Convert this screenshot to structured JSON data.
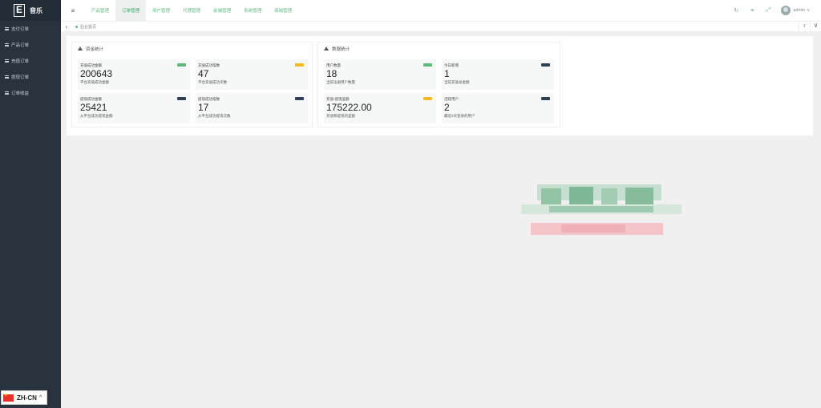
{
  "brand": {
    "logo_letter": "E",
    "name": "音乐"
  },
  "sidebar": {
    "items": [
      {
        "label": "支付订单"
      },
      {
        "label": "产品订单"
      },
      {
        "label": "充值订单"
      },
      {
        "label": "提现订单"
      },
      {
        "label": "订单收益"
      }
    ]
  },
  "language": {
    "label": "ZH-CN",
    "caret": "^"
  },
  "topnav": {
    "toggle_icon": "≡",
    "tabs": [
      {
        "label": "产品管理",
        "active": false
      },
      {
        "label": "订单管理",
        "active": true
      },
      {
        "label": "用户管理",
        "active": false
      },
      {
        "label": "代理管理",
        "active": false
      },
      {
        "label": "前端管理",
        "active": false
      },
      {
        "label": "系统管理",
        "active": false
      },
      {
        "label": "商城管理",
        "active": false
      }
    ],
    "refresh_icon": "↻",
    "clear_icon": "≡",
    "fullscreen_icon": "⤢",
    "username": "admin",
    "user_caret": "∨"
  },
  "pagebar": {
    "left_arrow": "‹",
    "tab_label": "后台首页",
    "right_arrow": "›",
    "down_arrow": "∨"
  },
  "panels": {
    "funds": {
      "title": "资金统计",
      "stats": [
        {
          "label": "充值成功金额",
          "value": "200643",
          "sub": "平台充值成功金额",
          "badge_color": "#5fb878"
        },
        {
          "label": "充值成功笔数",
          "value": "47",
          "sub": "平台充值成功次数",
          "badge_color": "#f7b824"
        },
        {
          "label": "提现成功金额",
          "value": "25421",
          "sub": "从平台成功提现金额",
          "badge_color": "#2f4056"
        },
        {
          "label": "提现成功笔数",
          "value": "17",
          "sub": "从平台成功提现次数",
          "badge_color": "#2f4056"
        }
      ]
    },
    "data": {
      "title": "数据统计",
      "stats": [
        {
          "label": "用户数量",
          "value": "18",
          "sub": "当前注册用户数量",
          "badge_color": "#5fb878"
        },
        {
          "label": "今日新增",
          "value": "1",
          "sub": "当前充值总金额",
          "badge_color": "#2f4056"
        },
        {
          "label": "充值-提现差额",
          "value": "175222.00",
          "sub": "充值和提现的差额",
          "badge_color": "#f7b824"
        },
        {
          "label": "活跃用户",
          "value": "2",
          "sub": "最近3天登录的用户",
          "badge_color": "#2f4056"
        }
      ]
    }
  },
  "colors": {
    "sidebar": "#28333e",
    "accent": "#5fb878",
    "warning": "#f7b824",
    "dark_badge": "#2f4056"
  }
}
